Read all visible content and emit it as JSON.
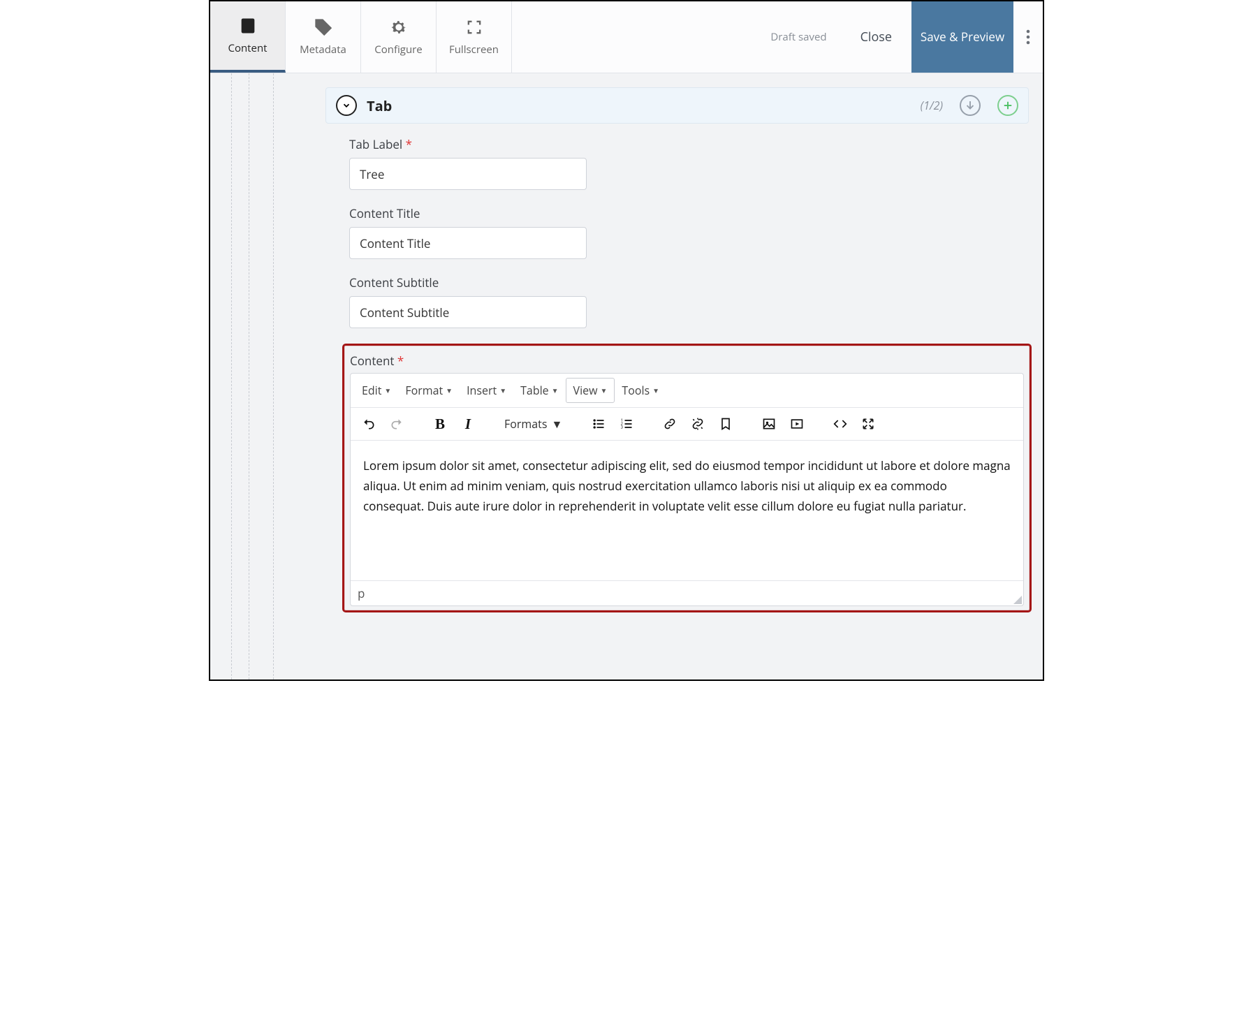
{
  "topbar": {
    "tabs": [
      {
        "label": "Content",
        "active": true,
        "icon": "document-icon"
      },
      {
        "label": "Metadata",
        "active": false,
        "icon": "tag-icon"
      },
      {
        "label": "Configure",
        "active": false,
        "icon": "gear-icon"
      },
      {
        "label": "Fullscreen",
        "active": false,
        "icon": "fullscreen-icon"
      }
    ],
    "draft_saved": "Draft saved",
    "close": "Close",
    "save_preview": "Save & Preview"
  },
  "section": {
    "title": "Tab",
    "counter": "(1/2)"
  },
  "fields": {
    "tab_label": {
      "label": "Tab Label",
      "required": true,
      "value": "Tree"
    },
    "content_title": {
      "label": "Content Title",
      "required": false,
      "placeholder": "Content Title",
      "value": ""
    },
    "content_subtitle": {
      "label": "Content Subtitle",
      "required": false,
      "placeholder": "Content Subtitle",
      "value": ""
    },
    "content": {
      "label": "Content",
      "required": true
    }
  },
  "editor": {
    "menus": [
      "Edit",
      "Format",
      "Insert",
      "Table",
      "View",
      "Tools"
    ],
    "active_menu": "View",
    "formats_label": "Formats",
    "body": "Lorem ipsum dolor sit amet, consectetur adipiscing elit, sed do eiusmod tempor incididunt ut labore et dolore magna aliqua. Ut enim ad minim veniam, quis nostrud exercitation ullamco laboris nisi ut aliquip ex ea commodo consequat. Duis aute irure dolor in reprehenderit in voluptate velit esse cillum dolore eu fugiat nulla pariatur.",
    "status": "p"
  }
}
